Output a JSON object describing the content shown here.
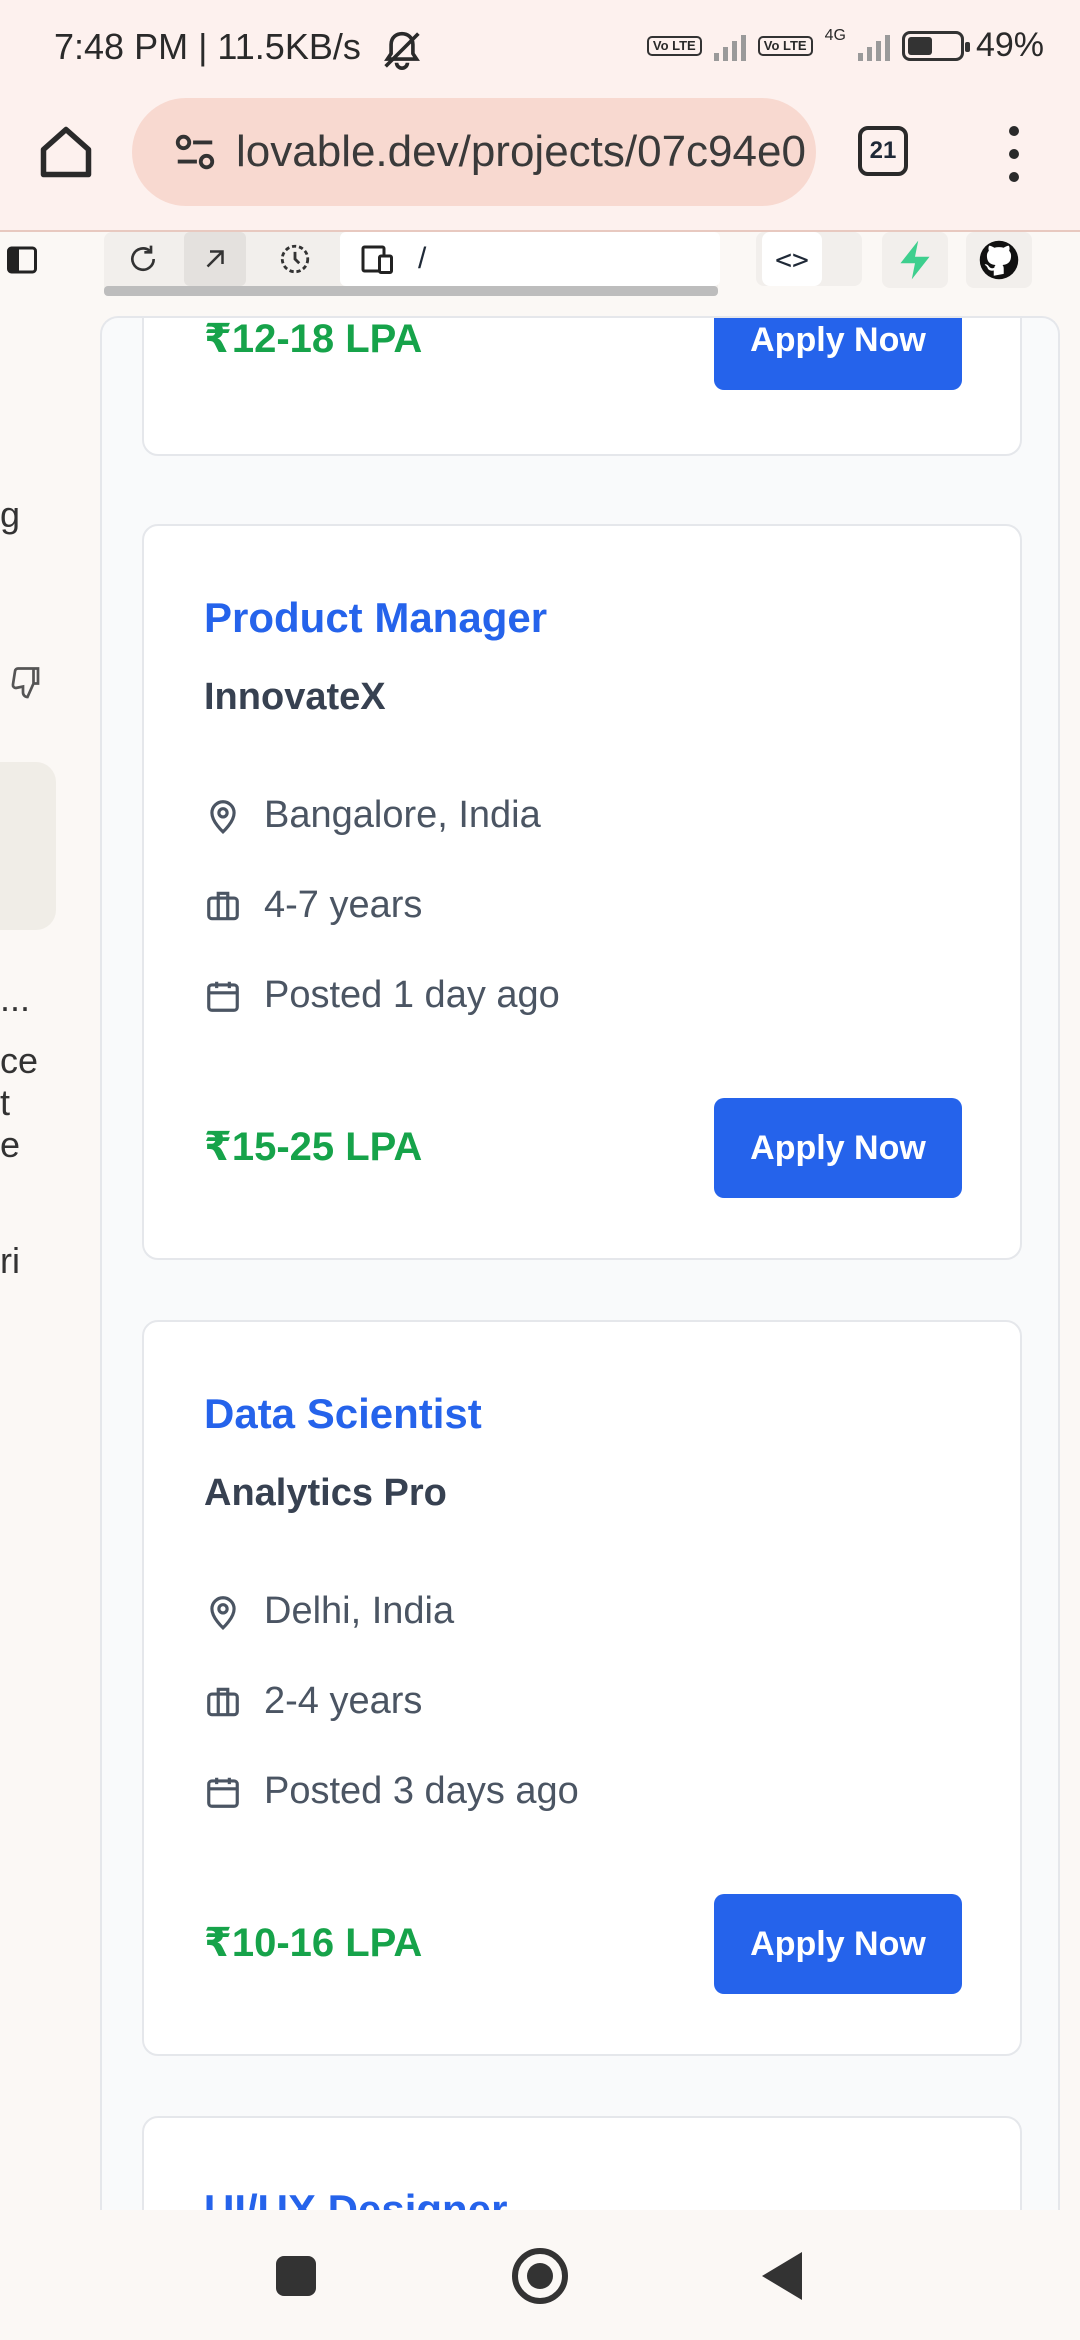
{
  "status": {
    "time": "7:48 PM | 11.5KB/s",
    "network_label": "4G",
    "volte_label": "Vo LTE",
    "battery": "49%",
    "battery_level": 0.49
  },
  "browser": {
    "url": "lovable.dev/projects/07c94e0",
    "tab_count": "21"
  },
  "toolbar": {
    "path": "/",
    "code_label": "<>"
  },
  "chat_fragments": [
    "g",
    "...",
    "ce",
    "t",
    "e",
    "ri"
  ],
  "jobs": [
    {
      "title": "",
      "company": "",
      "location": "",
      "experience": "",
      "posted": "",
      "salary": "₹12-18 LPA",
      "apply_label": "Apply Now"
    },
    {
      "title": "Product Manager",
      "company": "InnovateX",
      "location": "Bangalore, India",
      "experience": "4-7 years",
      "posted": "Posted 1 day ago",
      "salary": "₹15-25 LPA",
      "apply_label": "Apply Now"
    },
    {
      "title": "Data Scientist",
      "company": "Analytics Pro",
      "location": "Delhi, India",
      "experience": "2-4 years",
      "posted": "Posted 3 days ago",
      "salary": "₹10-16 LPA",
      "apply_label": "Apply Now"
    },
    {
      "title": "UI/UX Designer"
    }
  ],
  "colors": {
    "title_blue": "#2563eb",
    "salary_green": "#16a34a",
    "button_blue": "#2563eb"
  }
}
